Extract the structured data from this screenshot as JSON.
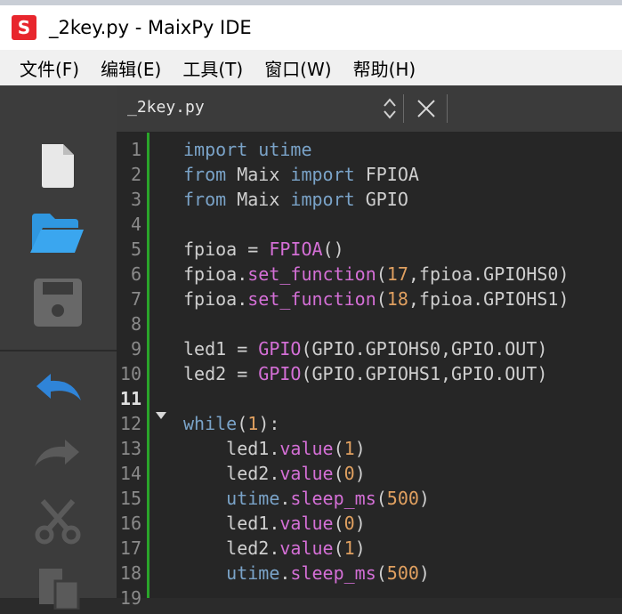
{
  "window": {
    "title": "_2key.py - MaixPy IDE",
    "logo_letter": "S"
  },
  "menu": [
    "文件(F)",
    "编辑(E)",
    "工具(T)",
    "窗口(W)",
    "帮助(H)"
  ],
  "sidebar": {
    "buttons": [
      "new-file-icon",
      "open-folder-icon",
      "save-icon",
      "undo-icon",
      "redo-icon",
      "cut-icon",
      "copy-icon"
    ]
  },
  "tab": {
    "filename": "_2key.py"
  },
  "colors": {
    "keyword": "#7aa3c8",
    "function": "#d46fd6",
    "number": "#e0a060",
    "plain": "#cfcfcf",
    "gutter_marker": "#2aa52a"
  },
  "editor": {
    "current_line": 11,
    "lines": [
      {
        "n": "1",
        "tokens": [
          [
            "kw",
            "import"
          ],
          [
            "pl",
            " "
          ],
          [
            "kw",
            "utime"
          ]
        ]
      },
      {
        "n": "2",
        "tokens": [
          [
            "kw",
            "from"
          ],
          [
            "pl",
            " Maix "
          ],
          [
            "kw",
            "import"
          ],
          [
            "pl",
            " FPIOA"
          ]
        ]
      },
      {
        "n": "3",
        "tokens": [
          [
            "kw",
            "from"
          ],
          [
            "pl",
            " Maix "
          ],
          [
            "kw",
            "import"
          ],
          [
            "pl",
            " GPIO"
          ]
        ]
      },
      {
        "n": "4",
        "tokens": []
      },
      {
        "n": "5",
        "tokens": [
          [
            "pl",
            "fpioa = "
          ],
          [
            "fn",
            "FPIOA"
          ],
          [
            "pl",
            "()"
          ]
        ]
      },
      {
        "n": "6",
        "tokens": [
          [
            "pl",
            "fpioa."
          ],
          [
            "mt",
            "set_function"
          ],
          [
            "pl",
            "("
          ],
          [
            "num",
            "17"
          ],
          [
            "pl",
            ",fpioa.GPIOHS0)"
          ]
        ]
      },
      {
        "n": "7",
        "tokens": [
          [
            "pl",
            "fpioa."
          ],
          [
            "mt",
            "set_function"
          ],
          [
            "pl",
            "("
          ],
          [
            "num",
            "18"
          ],
          [
            "pl",
            ",fpioa.GPIOHS1)"
          ]
        ]
      },
      {
        "n": "8",
        "tokens": []
      },
      {
        "n": "9",
        "tokens": [
          [
            "pl",
            "led1 = "
          ],
          [
            "fn",
            "GPIO"
          ],
          [
            "pl",
            "(GPIO.GPIOHS0,GPIO.OUT)"
          ]
        ]
      },
      {
        "n": "10",
        "tokens": [
          [
            "pl",
            "led2 = "
          ],
          [
            "fn",
            "GPIO"
          ],
          [
            "pl",
            "(GPIO.GPIOHS1,GPIO.OUT)"
          ]
        ]
      },
      {
        "n": "11",
        "tokens": []
      },
      {
        "n": "12",
        "tokens": [
          [
            "kw",
            "while"
          ],
          [
            "pl",
            "("
          ],
          [
            "num",
            "1"
          ],
          [
            "pl",
            "):"
          ]
        ]
      },
      {
        "n": "13",
        "tokens": [
          [
            "pl",
            "    led1."
          ],
          [
            "mt",
            "value"
          ],
          [
            "pl",
            "("
          ],
          [
            "num",
            "1"
          ],
          [
            "pl",
            ")"
          ]
        ]
      },
      {
        "n": "14",
        "tokens": [
          [
            "pl",
            "    led2."
          ],
          [
            "mt",
            "value"
          ],
          [
            "pl",
            "("
          ],
          [
            "num",
            "0"
          ],
          [
            "pl",
            ")"
          ]
        ]
      },
      {
        "n": "15",
        "tokens": [
          [
            "kw",
            "    utime"
          ],
          [
            "pl",
            "."
          ],
          [
            "mt",
            "sleep_ms"
          ],
          [
            "pl",
            "("
          ],
          [
            "num",
            "500"
          ],
          [
            "pl",
            ")"
          ]
        ]
      },
      {
        "n": "16",
        "tokens": [
          [
            "pl",
            "    led1."
          ],
          [
            "mt",
            "value"
          ],
          [
            "pl",
            "("
          ],
          [
            "num",
            "0"
          ],
          [
            "pl",
            ")"
          ]
        ]
      },
      {
        "n": "17",
        "tokens": [
          [
            "pl",
            "    led2."
          ],
          [
            "mt",
            "value"
          ],
          [
            "pl",
            "("
          ],
          [
            "num",
            "1"
          ],
          [
            "pl",
            ")"
          ]
        ]
      },
      {
        "n": "18",
        "tokens": [
          [
            "kw",
            "    utime"
          ],
          [
            "pl",
            "."
          ],
          [
            "mt",
            "sleep_ms"
          ],
          [
            "pl",
            "("
          ],
          [
            "num",
            "500"
          ],
          [
            "pl",
            ")"
          ]
        ]
      },
      {
        "n": "19",
        "tokens": []
      }
    ]
  }
}
